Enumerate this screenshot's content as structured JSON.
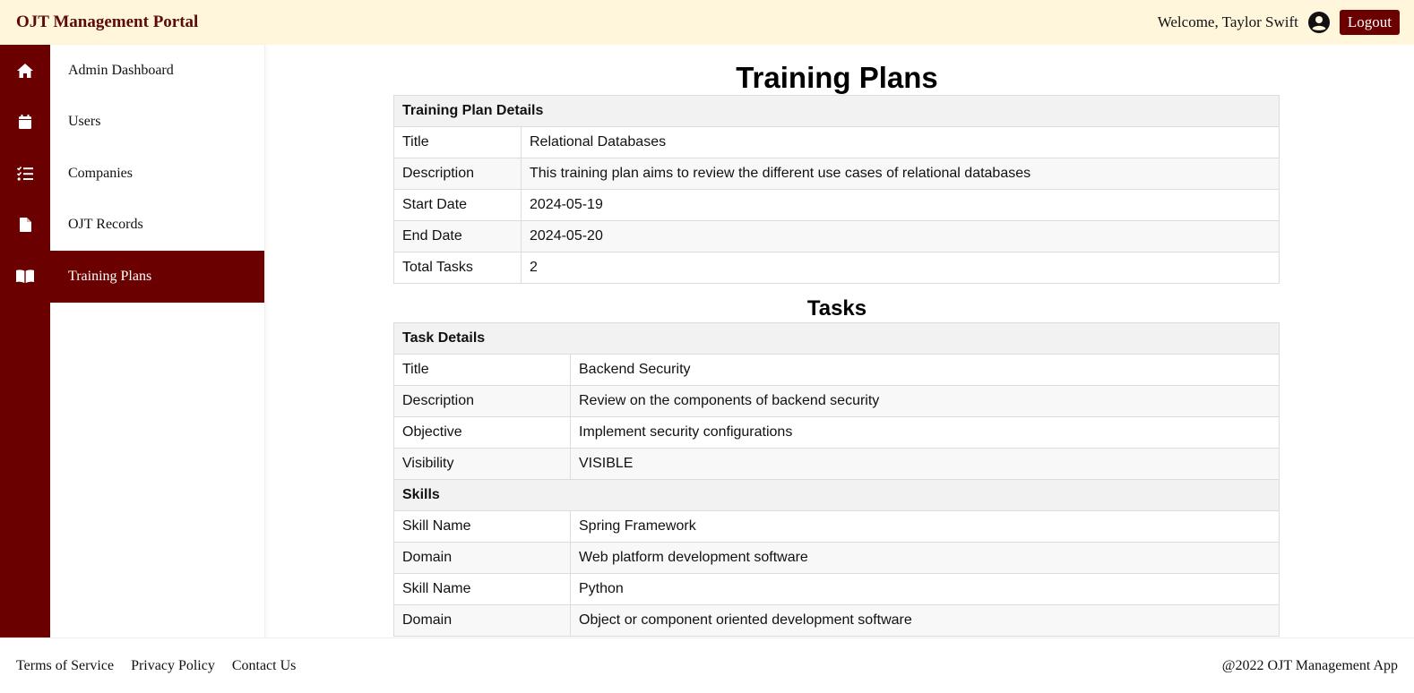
{
  "header": {
    "brand": "OJT Management Portal",
    "welcome": "Welcome, Taylor Swift",
    "user_icon": "user-circle-icon",
    "logout_label": "Logout",
    "background": "#fff6dc",
    "accent": "#6b0000"
  },
  "rail_icons": [
    "home-icon",
    "calendar-icon",
    "checklist-icon",
    "file-icon",
    "book-icon"
  ],
  "sidebar": {
    "items": [
      {
        "label": "Admin Dashboard",
        "active": false
      },
      {
        "label": "Users",
        "active": false
      },
      {
        "label": "Companies",
        "active": false
      },
      {
        "label": "OJT Records",
        "active": false
      },
      {
        "label": "Training Plans",
        "active": true
      }
    ]
  },
  "main": {
    "title": "Training Plans",
    "plan": {
      "header": "Training Plan Details",
      "rows": [
        {
          "key": "Title",
          "value": "Relational Databases"
        },
        {
          "key": "Description",
          "value": "This training plan aims to review the different use cases of relational databases"
        },
        {
          "key": "Start Date",
          "value": "2024-05-19"
        },
        {
          "key": "End Date",
          "value": "2024-05-20"
        },
        {
          "key": "Total Tasks",
          "value": "2"
        }
      ]
    },
    "tasks_title": "Tasks",
    "task": {
      "header": "Task Details",
      "rows": [
        {
          "key": "Title",
          "value": "Backend Security"
        },
        {
          "key": "Description",
          "value": "Review on the components of backend security"
        },
        {
          "key": "Objective",
          "value": "Implement security configurations"
        },
        {
          "key": "Visibility",
          "value": "VISIBLE"
        }
      ],
      "skills_header": "Skills",
      "skills": [
        {
          "key": "Skill Name",
          "value": "Spring Framework"
        },
        {
          "key": "Domain",
          "value": "Web platform development software"
        },
        {
          "key": "Skill Name",
          "value": "Python"
        },
        {
          "key": "Domain",
          "value": "Object or component oriented development software"
        }
      ]
    }
  },
  "footer": {
    "links": [
      "Terms of Service",
      "Privacy Policy",
      "Contact Us"
    ],
    "copyright": "@2022 OJT Management App"
  }
}
